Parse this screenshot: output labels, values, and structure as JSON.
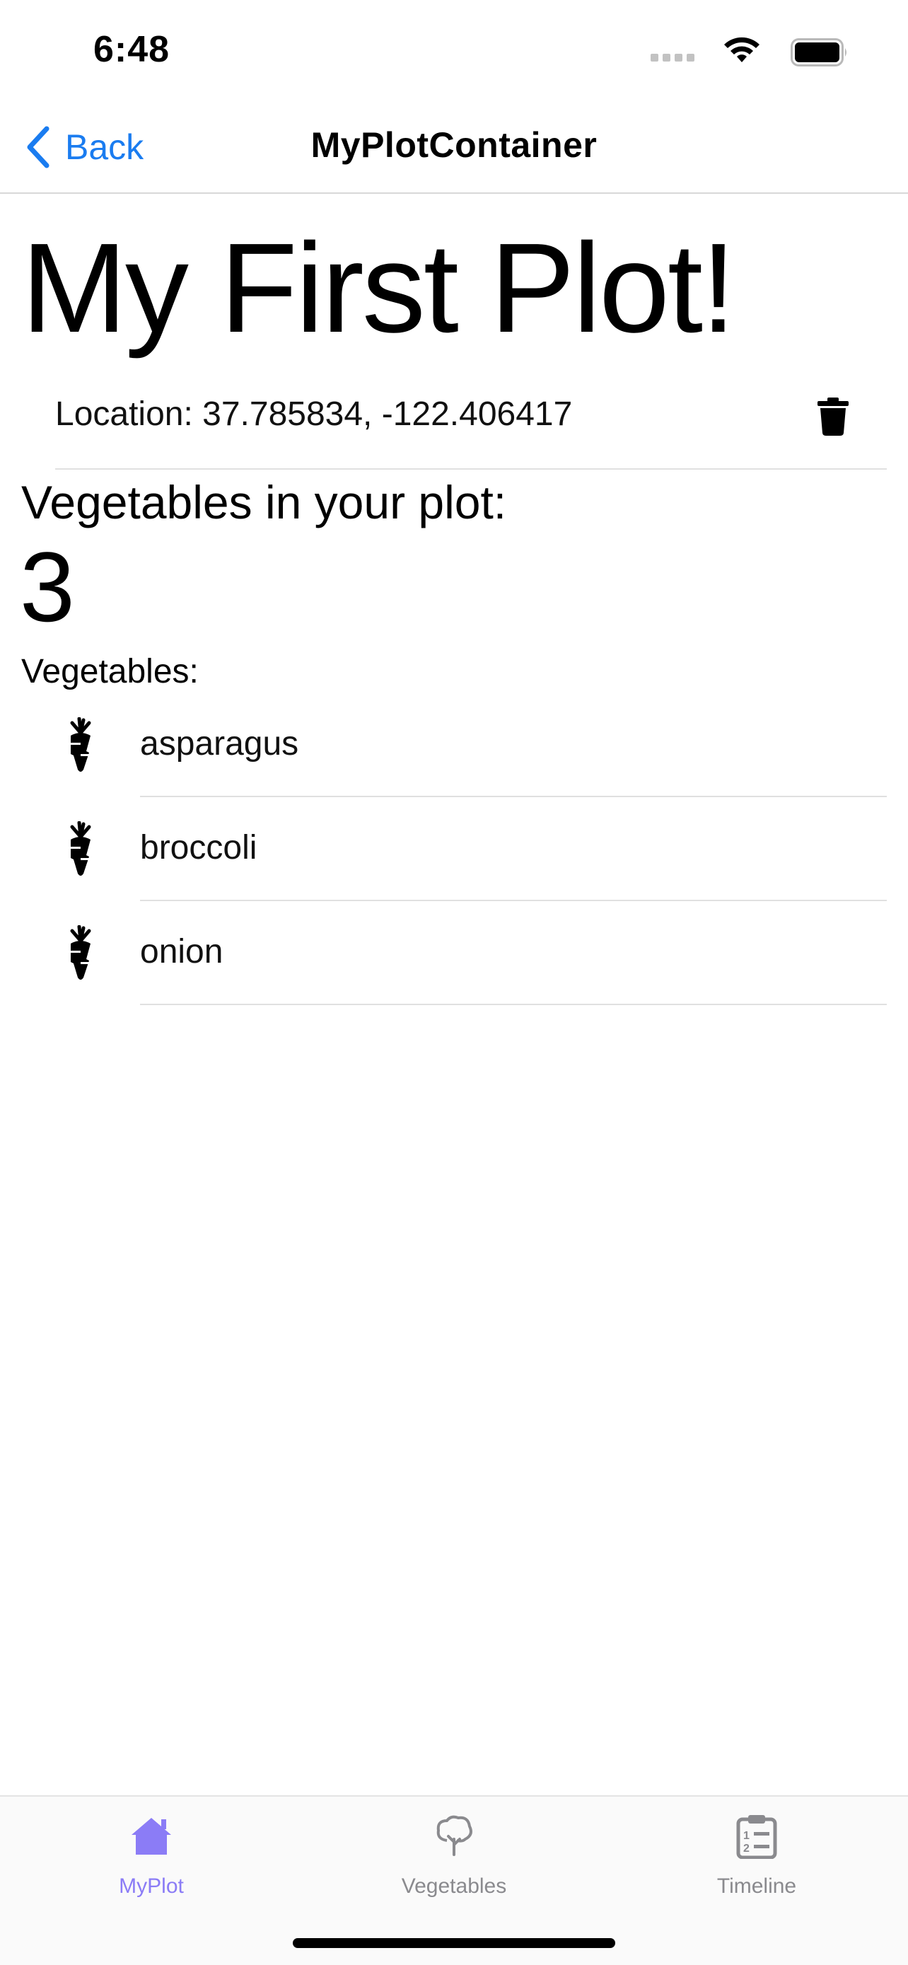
{
  "status_bar": {
    "time": "6:48",
    "icons": [
      "cellular-signal-icon",
      "wifi-icon",
      "battery-icon"
    ]
  },
  "nav": {
    "back_label": "Back",
    "title": "MyPlotContainer",
    "accent_color": "#1a7cf0"
  },
  "plot": {
    "title": "My First Plot!",
    "location": "Location: 37.785834, -122.406417",
    "delete_icon": "trash-icon"
  },
  "vegetables": {
    "count_label": "Vegetables in your plot:",
    "count": "3",
    "list_label": "Vegetables:",
    "items": [
      {
        "name": "asparagus",
        "icon": "carrot-icon"
      },
      {
        "name": "broccoli",
        "icon": "carrot-icon"
      },
      {
        "name": "onion",
        "icon": "carrot-icon"
      }
    ]
  },
  "tab_bar": {
    "active_color": "#8b7cf6",
    "inactive_color": "#8a8a8e",
    "tabs": [
      {
        "label": "MyPlot",
        "icon": "house-icon",
        "active": true
      },
      {
        "label": "Vegetables",
        "icon": "tree-icon",
        "active": false
      },
      {
        "label": "Timeline",
        "icon": "list-clipboard-icon",
        "active": false
      }
    ]
  }
}
